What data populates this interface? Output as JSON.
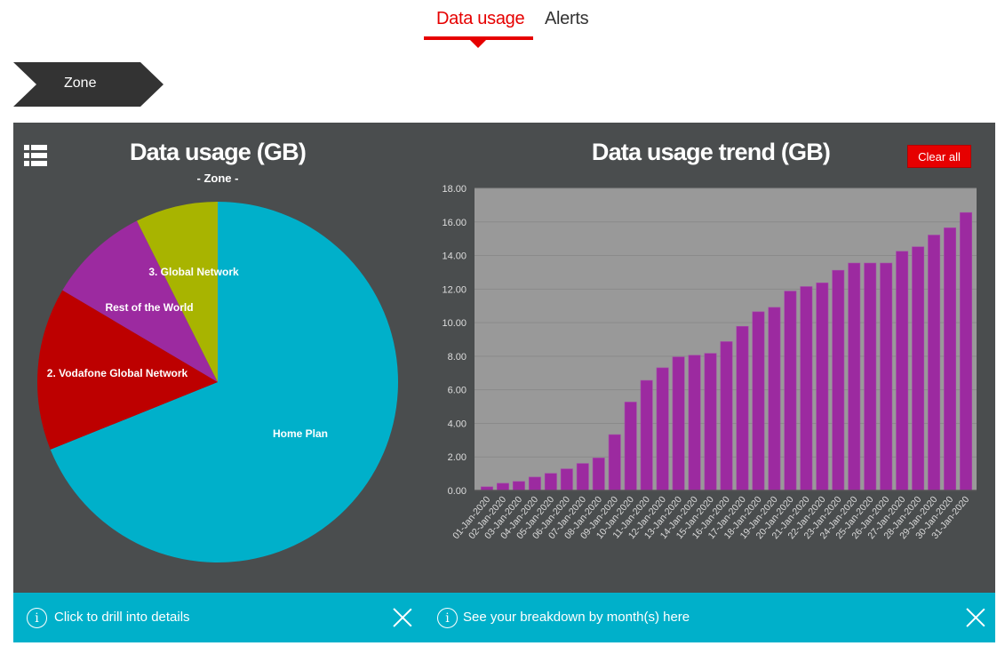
{
  "tabs": [
    {
      "label": "Data usage",
      "active": true
    },
    {
      "label": "Alerts",
      "active": false
    }
  ],
  "breadcrumb": {
    "label": "Zone"
  },
  "menu_icon": "list-menu-icon",
  "pie_panel": {
    "title": "Data usage (GB)",
    "subtitle": "- Zone -"
  },
  "bar_panel": {
    "title": "Data usage trend (GB)",
    "clear_label": "Clear all"
  },
  "info_bars": [
    {
      "icon": "info-icon",
      "icon_glyph": "i",
      "text": "Click to drill into details"
    },
    {
      "icon": "info-icon",
      "icon_glyph": "i",
      "text": "See your breakdown by month(s) here"
    }
  ],
  "colors": {
    "brand_red": "#e60000",
    "panel_bg": "#4a4d4e",
    "info_bg": "#00b0ca",
    "plot_bg": "#999999",
    "bar": "#9c2aa0"
  },
  "chart_data": [
    {
      "type": "pie",
      "title": "Data usage (GB)",
      "subtitle": "- Zone -",
      "start": "top, clockwise",
      "slices": [
        {
          "label": "Home Plan",
          "value": 68.9,
          "color": "#00b0ca"
        },
        {
          "label": "2. Vodafone Global Network",
          "value": 14.6,
          "color": "#bd0000"
        },
        {
          "label": "Rest of the World",
          "value": 9.1,
          "color": "#9c2aa0"
        },
        {
          "label": "3. Global Network",
          "value": 7.4,
          "color": "#a8b400"
        }
      ],
      "unit": "percent of total"
    },
    {
      "type": "bar",
      "title": "Data usage trend (GB)",
      "xlabel": "",
      "ylabel": "",
      "ylim": [
        0,
        18
      ],
      "yticks": [
        "0.00",
        "2.00",
        "4.00",
        "6.00",
        "8.00",
        "10.00",
        "12.00",
        "14.00",
        "16.00",
        "18.00"
      ],
      "grid": true,
      "categories": [
        "01-Jan-2020",
        "02-Jan-2020",
        "03-Jan-2020",
        "04-Jan-2020",
        "05-Jan-2020",
        "06-Jan-2020",
        "07-Jan-2020",
        "08-Jan-2020",
        "09-Jan-2020",
        "10-Jan-2020",
        "11-Jan-2020",
        "12-Jan-2020",
        "13-Jan-2020",
        "14-Jan-2020",
        "15-Jan-2020",
        "16-Jan-2020",
        "17-Jan-2020",
        "18-Jan-2020",
        "19-Jan-2020",
        "20-Jan-2020",
        "21-Jan-2020",
        "22-Jan-2020",
        "23-Jan-2020",
        "24-Jan-2020",
        "25-Jan-2020",
        "26-Jan-2020",
        "27-Jan-2020",
        "28-Jan-2020",
        "29-Jan-2020",
        "30-Jan-2020",
        "31-Jan-2020"
      ],
      "values": [
        0.22,
        0.43,
        0.54,
        0.8,
        1.02,
        1.29,
        1.61,
        1.94,
        3.33,
        5.27,
        6.56,
        7.31,
        7.96,
        8.06,
        8.17,
        8.87,
        9.78,
        10.65,
        10.91,
        11.88,
        12.15,
        12.37,
        13.12,
        13.55,
        13.55,
        13.55,
        14.25,
        14.52,
        15.22,
        15.65,
        16.56
      ],
      "color": "#9c2aa0"
    }
  ]
}
